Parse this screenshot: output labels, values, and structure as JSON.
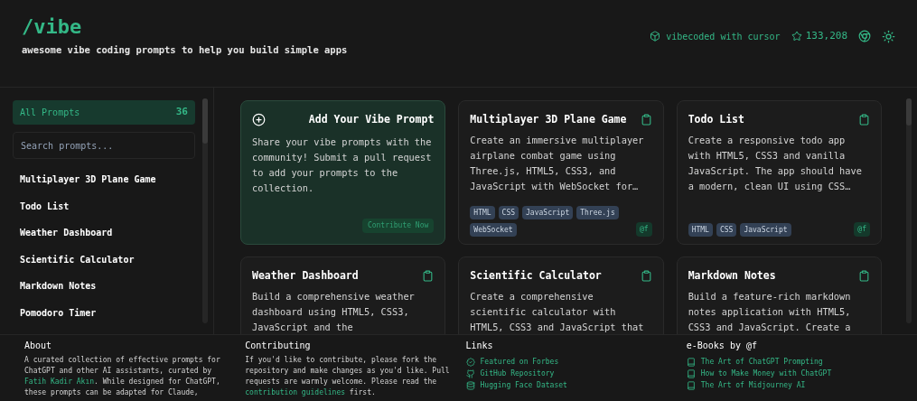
{
  "header": {
    "title": "/vibe",
    "subtitle": "awesome vibe coding prompts to help you build simple apps",
    "badge": "vibecoded with cursor",
    "stars": "133,208"
  },
  "sidebar": {
    "all_prompts": {
      "label": "All Prompts",
      "count": "36",
      "selected": true
    },
    "search": {
      "placeholder": "Search prompts..."
    },
    "items": [
      "Multiplayer 3D Plane Game",
      "Todo List",
      "Weather Dashboard",
      "Scientific Calculator",
      "Markdown Notes",
      "Pomodoro Timer"
    ]
  },
  "add_card": {
    "title": "Add Your Vibe Prompt",
    "text": "Share your vibe prompts with the community! Submit a pull request to add your prompts to the collection.",
    "button": "Contribute Now"
  },
  "cards": [
    {
      "title": "Multiplayer 3D Plane Game",
      "description": "Create an immersive multiplayer airplane combat game using Three.js, HTML5, CSS3, and JavaScript with WebSocket for…",
      "tags": [
        "HTML",
        "CSS",
        "JavaScript",
        "Three.js",
        "WebSocket"
      ],
      "author": "@f"
    },
    {
      "title": "Todo List",
      "description": "Create a responsive todo app with HTML5, CSS3 and vanilla JavaScript. The app should have a modern, clean UI using CSS…",
      "tags": [
        "HTML",
        "CSS",
        "JavaScript"
      ],
      "author": "@f"
    },
    {
      "title": "Weather Dashboard",
      "description": "Build a comprehensive weather dashboard using HTML5, CSS3, JavaScript and the"
    },
    {
      "title": "Scientific Calculator",
      "description": "Create a comprehensive scientific calculator with HTML5, CSS3 and JavaScript that"
    },
    {
      "title": "Markdown Notes",
      "description": "Build a feature-rich markdown notes application with HTML5, CSS3 and JavaScript. Create a"
    }
  ],
  "footer": {
    "about": {
      "heading": "About",
      "before": "A curated collection of effective prompts for ChatGPT and other AI assistants, curated by",
      "link": "Fatih Kadir Akın",
      "after": ". While designed for ChatGPT, these prompts can be adapted for Claude,"
    },
    "contributing": {
      "heading": "Contributing",
      "before": "If you'd like to contribute, please fork the repository and make changes as you'd like. Pull requests are warmly welcome. Please read the",
      "link": "contribution guidelines",
      "after": "first."
    },
    "links": {
      "heading": "Links",
      "items": [
        "Featured on Forbes",
        "GitHub Repository",
        "Hugging Face Dataset"
      ]
    },
    "ebooks": {
      "heading": "e-Books by @f",
      "items": [
        "The Art of ChatGPT Prompting",
        "How to Make Money with ChatGPT",
        "The Art of Midjourney AI"
      ]
    }
  }
}
